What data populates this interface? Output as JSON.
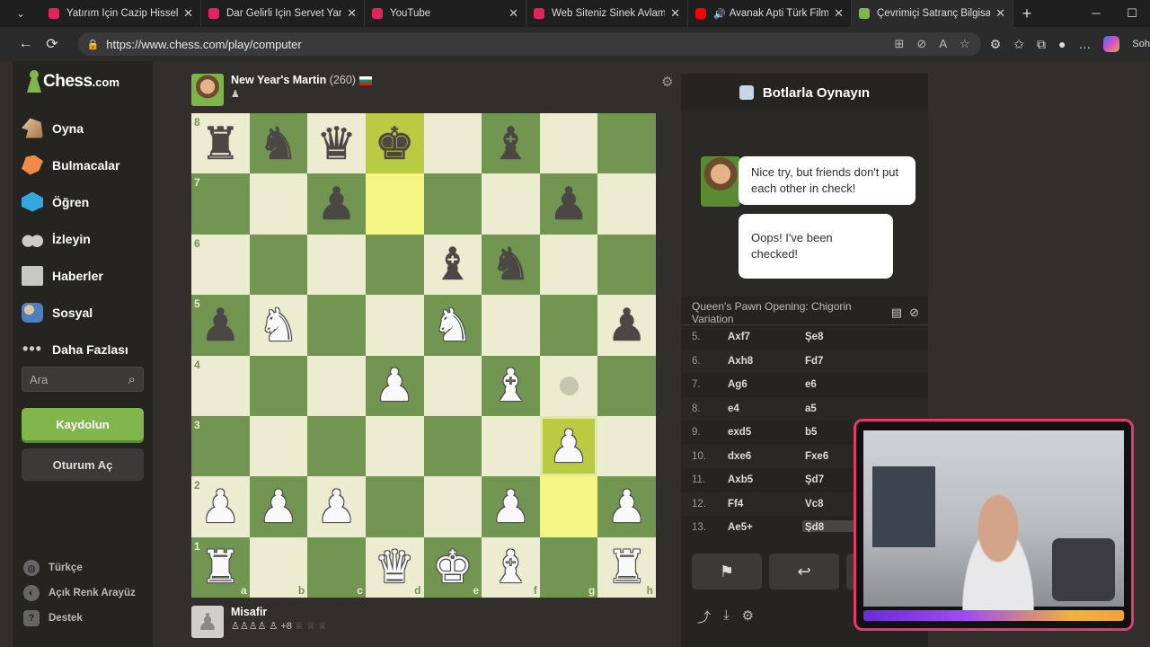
{
  "browser": {
    "tabs": [
      {
        "title": "Yatırım İçin Cazip Hisseler Oca",
        "color": "#e0245e"
      },
      {
        "title": "Dar Gelirli İçin Servet Yaratma",
        "color": "#e0245e"
      },
      {
        "title": "YouTube",
        "color": "#e0245e"
      },
      {
        "title": "Web Siteniz Sinek Avlamasın!",
        "color": "#e0245e"
      },
      {
        "title": "Avanak Apti Türk Filmi | ",
        "color": "#ff0000"
      },
      {
        "title": "Çevrimiçi Satranç Bilgisayara",
        "color": "#81b64c"
      }
    ],
    "url": "https://www.chess.com/play/computer",
    "sohbet_label": "Soh"
  },
  "sidebar": {
    "logo_text": "Chess",
    "logo_suffix": ".com",
    "items": [
      {
        "label": "Oyna",
        "icon": "play-icon"
      },
      {
        "label": "Bulmacalar",
        "icon": "puzzle-icon"
      },
      {
        "label": "Öğren",
        "icon": "learn-icon"
      },
      {
        "label": "İzleyin",
        "icon": "watch-icon"
      },
      {
        "label": "Haberler",
        "icon": "news-icon"
      },
      {
        "label": "Sosyal",
        "icon": "social-icon"
      },
      {
        "label": "Daha Fazlası",
        "icon": "more-icon"
      }
    ],
    "search_placeholder": "Ara",
    "signup": "Kaydolun",
    "login": "Oturum Aç",
    "footer": [
      {
        "label": "Türkçe",
        "icon": "globe-icon"
      },
      {
        "label": "Açık Renk Arayüz",
        "icon": "contrast-icon"
      },
      {
        "label": "Destek",
        "icon": "help-icon"
      }
    ]
  },
  "opponent": {
    "name": "New Year's Martin",
    "rating": "(260)",
    "captured": "♟"
  },
  "player": {
    "name": "Misafir",
    "captured": "♙♙♙♙ ♙",
    "advantage": "+8",
    "captured_extra": "♕ ♕ ♕"
  },
  "board": {
    "ranks": [
      "8",
      "7",
      "6",
      "5",
      "4",
      "3",
      "2",
      "1"
    ],
    "files": [
      "a",
      "b",
      "c",
      "d",
      "e",
      "f",
      "g",
      "h"
    ],
    "position": [
      [
        "br",
        "bn",
        "bq",
        "bk",
        "",
        "bb",
        "",
        ""
      ],
      [
        "",
        "",
        "bp",
        "",
        "",
        "",
        "bp",
        ""
      ],
      [
        "",
        "",
        "",
        "",
        "bb",
        "bn",
        "",
        ""
      ],
      [
        "bp",
        "wn",
        "",
        "",
        "wn",
        "",
        "",
        "bp"
      ],
      [
        "",
        "",
        "",
        "wp",
        "",
        "wb",
        "dot",
        ""
      ],
      [
        "",
        "",
        "",
        "",
        "",
        "",
        "wp",
        ""
      ],
      [
        "wp",
        "wp",
        "wp",
        "",
        "",
        "wp",
        "",
        "wp"
      ],
      [
        "wr",
        "",
        "",
        "wq",
        "wk",
        "wb",
        "",
        "wr"
      ]
    ],
    "highlights": [
      "d8",
      "d7",
      "g2",
      "g3"
    ],
    "hover": [
      "g3"
    ]
  },
  "panel": {
    "title": "Botlarla Oynayın",
    "chat": [
      "Nice try, but friends don't put each other in check!",
      "Oops! I've been checked!"
    ],
    "opening": "Queen's Pawn Opening: Chigorin Variation",
    "moves": [
      {
        "n": "5.",
        "w": "Axf7",
        "b": "Şe8"
      },
      {
        "n": "6.",
        "w": "Axh8",
        "b": "Fd7"
      },
      {
        "n": "7.",
        "w": "Ag6",
        "b": "e6"
      },
      {
        "n": "8.",
        "w": "e4",
        "b": "a5"
      },
      {
        "n": "9.",
        "w": "exd5",
        "b": "b5"
      },
      {
        "n": "10.",
        "w": "dxe6",
        "b": "Fxe6"
      },
      {
        "n": "11.",
        "w": "Axb5",
        "b": "Şd7"
      },
      {
        "n": "12.",
        "w": "Ff4",
        "b": "Vc8"
      },
      {
        "n": "13.",
        "w": "Ae5+",
        "b": "Şd8"
      }
    ]
  },
  "colors": {
    "board_light": "#ebecd0",
    "board_dark": "#739552",
    "accent_green": "#81b64c"
  }
}
